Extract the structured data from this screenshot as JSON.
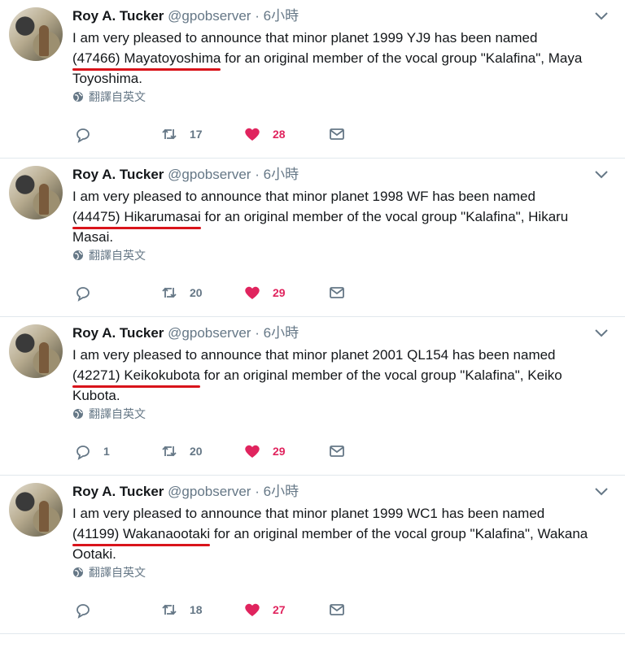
{
  "tweets": [
    {
      "name": "Roy A. Tucker",
      "handle": "@gpobserver",
      "dot": "·",
      "time": "6小時",
      "text_before": "I am very pleased to announce that minor planet 1999 YJ9 has been named ",
      "highlight": "(47466) Mayatoyoshima",
      "text_after": " for an original member of the vocal group \"Kalafina\", Maya Toyoshima.",
      "translate": "翻譯自英文",
      "replies": "",
      "retweets": "17",
      "likes": "28"
    },
    {
      "name": "Roy A. Tucker",
      "handle": "@gpobserver",
      "dot": "·",
      "time": "6小時",
      "text_before": "I am very pleased to announce that minor planet 1998 WF has been named ",
      "highlight": "(44475) Hikarumasai",
      "text_after": " for an original member of the vocal group \"Kalafina\", Hikaru Masai.",
      "translate": "翻譯自英文",
      "replies": "",
      "retweets": "20",
      "likes": "29"
    },
    {
      "name": "Roy A. Tucker",
      "handle": "@gpobserver",
      "dot": "·",
      "time": "6小時",
      "text_before": "I am very pleased to announce that minor planet 2001 QL154 has been named ",
      "highlight": "(42271) Keikokubota",
      "text_after": " for an original member of the vocal group \"Kalafina\", Keiko Kubota.",
      "translate": "翻譯自英文",
      "replies": "1",
      "retweets": "20",
      "likes": "29"
    },
    {
      "name": "Roy A. Tucker",
      "handle": "@gpobserver",
      "dot": "·",
      "time": "6小時",
      "text_before": "I am very pleased to announce that minor planet 1999 WC1 has been named ",
      "highlight": "(41199) Wakanaootaki",
      "text_after": " for an original member of the vocal group \"Kalafina\", Wakana Ootaki.",
      "translate": "翻譯自英文",
      "replies": "",
      "retweets": "18",
      "likes": "27"
    }
  ],
  "icons": {
    "reply": "reply-icon",
    "retweet": "retweet-icon",
    "like": "heart-icon",
    "message": "message-icon",
    "globe": "globe-icon",
    "more": "chevron-down-icon"
  },
  "colors": {
    "like": "#e0245e",
    "muted": "#657786",
    "underline": "#d9141b",
    "divider": "#e1e8ed"
  }
}
